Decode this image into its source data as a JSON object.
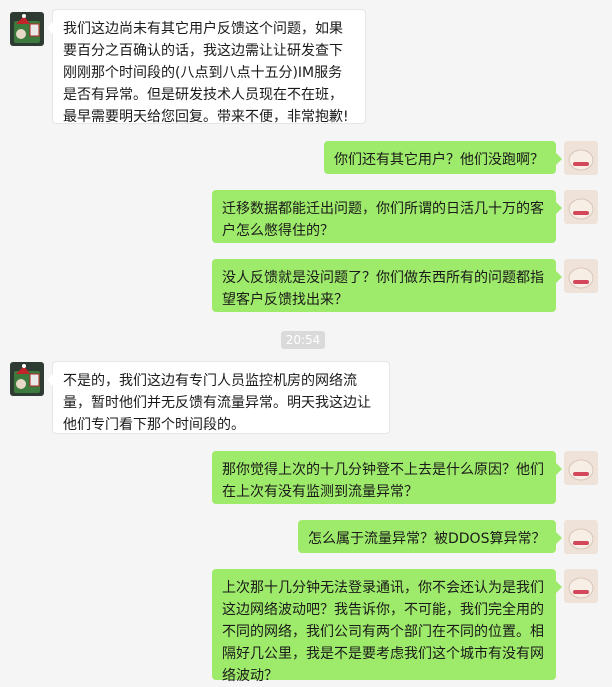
{
  "messages": [
    {
      "side": "left",
      "text": "我们这边尚未有其它用户反馈这个问题，如果要百分之百确认的话，我这边需让让研发查下刚刚那个时间段的(八点到八点十五分)IM服务是否有异常。但是研发技术人员现在不在班，最早需要明天给您回复。带来不便，非常抱歉!"
    },
    {
      "side": "right",
      "text": "你们还有其它用户？他们没跑啊？"
    },
    {
      "side": "right",
      "text": "迁移数据都能迁出问题，你们所谓的日活几十万的客户怎么憋得住的？"
    },
    {
      "side": "right",
      "text": "没人反馈就是没问题了？你们做东西所有的问题都指望客户反馈找出来？"
    },
    {
      "side": "left",
      "text": "不是的，我们这边有专门人员监控机房的网络流量，暂时他们并无反馈有流量异常。明天我这边让他们专门看下那个时间段的。"
    },
    {
      "side": "right",
      "text": "那你觉得上次的十几分钟登不上去是什么原因？他们在上次有没有监测到流量异常？"
    },
    {
      "side": "right",
      "text": "怎么属于流量异常？被DDOS算异常？"
    },
    {
      "side": "right",
      "text": "上次那十几分钟无法登录通讯，你不会还认为是我们这边网络波动吧？我告诉你，不可能，我们完全用的不同的网络，我们公司有两个部门在不同的位置。相隔好几公里，我是不是要考虑我们这个城市有没有网络波动？"
    }
  ],
  "timestamp": "20:54",
  "colors": {
    "background": "#f5f5f5",
    "bubble_self": "#9eea6a",
    "bubble_other": "#ffffff"
  }
}
